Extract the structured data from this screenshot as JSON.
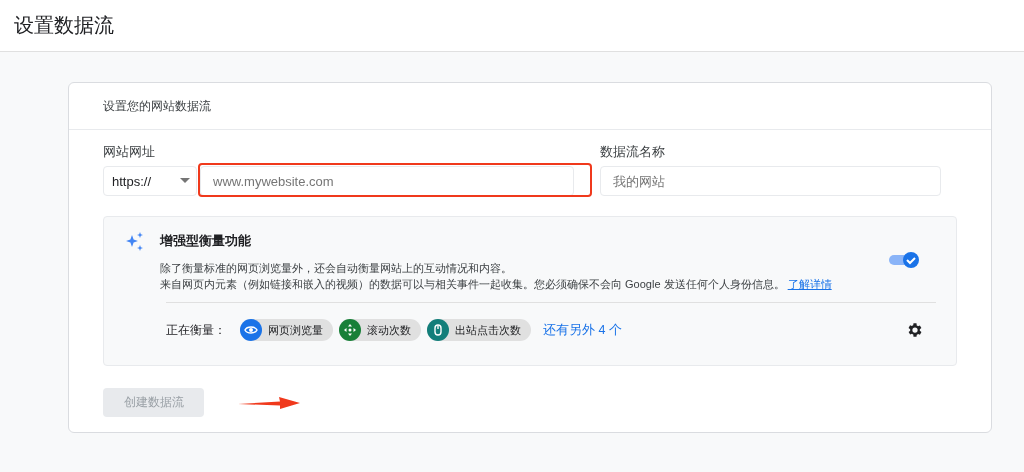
{
  "page": {
    "title": "设置数据流"
  },
  "card": {
    "heading": "设置您的网站数据流",
    "url_field": {
      "label": "网站网址",
      "protocol": "https://",
      "placeholder": "www.mywebsite.com",
      "highlighted": true
    },
    "name_field": {
      "label": "数据流名称",
      "placeholder": "我的网站"
    },
    "enhanced": {
      "title": "增强型衡量功能",
      "line_1": "除了衡量标准的网页浏览量外，还会自动衡量网站上的互动情况和内容。",
      "line_2": "来自网页内元素（例如链接和嵌入的视频）的数据可以与相关事件一起收集。您必须确保不会向 Google 发送任何个人身份信息。",
      "link": "了解详情",
      "on": true,
      "measuring_label": "正在衡量：",
      "chips": [
        {
          "kind": "eye",
          "label": "网页浏览量",
          "color": "#1a73e8"
        },
        {
          "kind": "scroll",
          "label": "滚动次数",
          "color": "#188038"
        },
        {
          "kind": "mouse",
          "label": "出站点击次数",
          "color": "#137e7a"
        }
      ],
      "more_link": "还有另外 4 个"
    },
    "create_button": {
      "label": "创建数据流",
      "disabled": true
    }
  }
}
